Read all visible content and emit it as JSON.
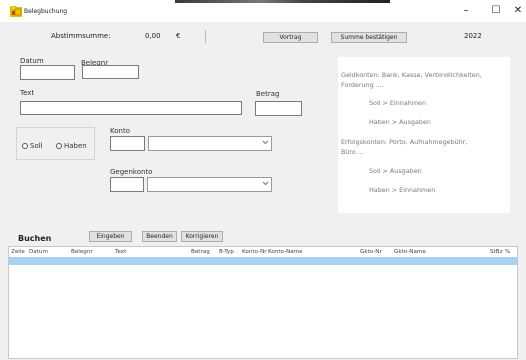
{
  "window": {
    "title": "Belegbuchung",
    "minimize_glyph": "–",
    "maximize_glyph": "☐",
    "close_glyph": "✕"
  },
  "topbar": {
    "sum_label": "Abstimmsumme:",
    "sum_value": "0,00",
    "currency": "€",
    "carryover_button": "Vortrag",
    "confirm_button": "Summe bestätigen",
    "year": "2022"
  },
  "form": {
    "date_label": "Datum",
    "date_value": "",
    "receipt_no_label": "Belegnr",
    "receipt_no_value": "",
    "text_label": "Text",
    "text_value": "",
    "amount_label": "Betrag",
    "amount_value": "",
    "debit_label": "Soll",
    "credit_label": "Haben",
    "account_label": "Konto",
    "account_value": "",
    "account_select_value": "",
    "contra_account_label": "Gegenkonto",
    "contra_account_value": "",
    "contra_account_select_value": ""
  },
  "info": {
    "line1": "Geldkonten: Bank, Kasse, Verbindlichkeiten,",
    "line2": "Forderung ....",
    "soll1": "Soll       > Einnahmen",
    "haben1": "Haben > Ausgaben",
    "line3": "Erfolgskonten: Porto, Aufnahmegebühr,",
    "line4": "Büro ...",
    "soll2": "Soll       > Ausgaben",
    "haben2": "Haben > Einnahmen"
  },
  "booking": {
    "title": "Buchen",
    "enter_button": "Eingeben",
    "finish_button": "Beenden",
    "correct_button": "Korrigieren"
  },
  "table": {
    "columns": [
      "Zeile",
      "Datum",
      "Belegnr",
      "Text",
      "Betrag",
      "B-Typ",
      "Konto-Nr",
      "Konto-Name",
      "Gkto-Nr",
      "Gkto-Name",
      "StBz",
      "%"
    ],
    "rows": []
  },
  "colors": {
    "window_bg": "#f0f0f0",
    "selection_row": "#a9d2f0",
    "info_text": "#7a7a7a"
  }
}
